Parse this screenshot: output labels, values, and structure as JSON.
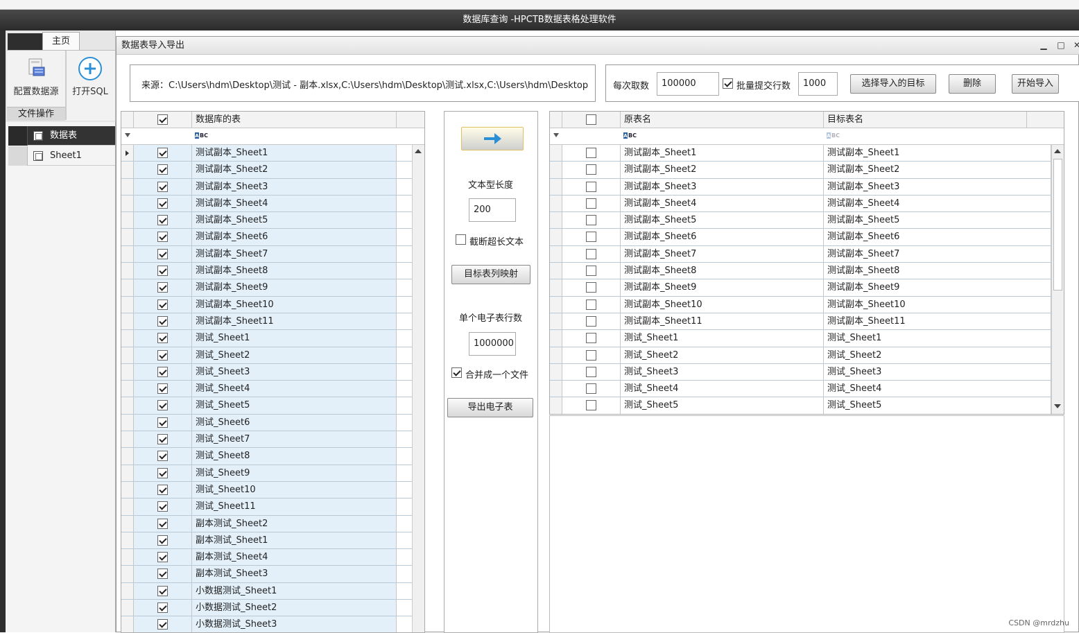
{
  "app": {
    "title": "数据库查询 -HPCTB数据表格处理软件"
  },
  "ribbon": {
    "tab_home": "主页",
    "btn_config_source": "配置数据源",
    "btn_open_sql": "打开SQL",
    "group_file_ops": "文件操作"
  },
  "left_panel": {
    "header": "数据表",
    "items": [
      "Sheet1"
    ]
  },
  "window": {
    "title": "数据表导入导出",
    "source_text": "来源：C:\\Users\\hdm\\Desktop\\测试 - 副本.xlsx,C:\\Users\\hdm\\Desktop\\测试.xlsx,C:\\Users\\hdm\\Desktop"
  },
  "options": {
    "per_fetch_label": "每次取数",
    "per_fetch_value": "100000",
    "batch_commit_label": "批量提交行数",
    "batch_commit_value": "1000",
    "btn_select_target": "选择导入的目标",
    "btn_delete": "删除",
    "btn_start_import": "开始导入"
  },
  "middle": {
    "text_len_label": "文本型长度",
    "text_len_value": "200",
    "truncate_label": "截断超长文本",
    "btn_column_mapping": "目标表列映射",
    "rows_per_sheet_label": "单个电子表行数",
    "rows_per_sheet_value": "1000000",
    "merge_label": "合并成一个文件",
    "btn_export": "导出电子表"
  },
  "left_grid": {
    "column_header": "数据库的表",
    "rows": [
      "测试副本_Sheet1",
      "测试副本_Sheet2",
      "测试副本_Sheet3",
      "测试副本_Sheet4",
      "测试副本_Sheet5",
      "测试副本_Sheet6",
      "测试副本_Sheet7",
      "测试副本_Sheet8",
      "测试副本_Sheet9",
      "测试副本_Sheet10",
      "测试副本_Sheet11",
      "测试_Sheet1",
      "测试_Sheet2",
      "测试_Sheet3",
      "测试_Sheet4",
      "测试_Sheet5",
      "测试_Sheet6",
      "测试_Sheet7",
      "测试_Sheet8",
      "测试_Sheet9",
      "测试_Sheet10",
      "测试_Sheet11",
      "副本测试_Sheet2",
      "副本测试_Sheet1",
      "副本测试_Sheet4",
      "副本测试_Sheet3",
      "小数据测试_Sheet1",
      "小数据测试_Sheet2",
      "小数据测试_Sheet3"
    ]
  },
  "right_grid": {
    "col_source": "原表名",
    "col_target": "目标表名",
    "rows": [
      {
        "src": "测试副本_Sheet1",
        "dst": "测试副本_Sheet1"
      },
      {
        "src": "测试副本_Sheet2",
        "dst": "测试副本_Sheet2"
      },
      {
        "src": "测试副本_Sheet3",
        "dst": "测试副本_Sheet3"
      },
      {
        "src": "测试副本_Sheet4",
        "dst": "测试副本_Sheet4"
      },
      {
        "src": "测试副本_Sheet5",
        "dst": "测试副本_Sheet5"
      },
      {
        "src": "测试副本_Sheet6",
        "dst": "测试副本_Sheet6"
      },
      {
        "src": "测试副本_Sheet7",
        "dst": "测试副本_Sheet7"
      },
      {
        "src": "测试副本_Sheet8",
        "dst": "测试副本_Sheet8"
      },
      {
        "src": "测试副本_Sheet9",
        "dst": "测试副本_Sheet9"
      },
      {
        "src": "测试副本_Sheet10",
        "dst": "测试副本_Sheet10"
      },
      {
        "src": "测试副本_Sheet11",
        "dst": "测试副本_Sheet11"
      },
      {
        "src": "测试_Sheet1",
        "dst": "测试_Sheet1"
      },
      {
        "src": "测试_Sheet2",
        "dst": "测试_Sheet2"
      },
      {
        "src": "测试_Sheet3",
        "dst": "测试_Sheet3"
      },
      {
        "src": "测试_Sheet4",
        "dst": "测试_Sheet4"
      },
      {
        "src": "测试_Sheet5",
        "dst": "测试_Sheet5"
      }
    ]
  },
  "filter_abc": "BC",
  "filter_abc_prefix": "A",
  "watermark": "CSDN @mrdzhu",
  "icons": [
    "database-icon",
    "plus-circle-icon",
    "arrow-right-icon",
    "funnel-icon",
    "minimize-icon",
    "maximize-icon",
    "close-icon"
  ],
  "colors": {
    "titlebar": "#333333",
    "selected_row": "#e3f0fa",
    "accent": "#2b8fd6"
  }
}
